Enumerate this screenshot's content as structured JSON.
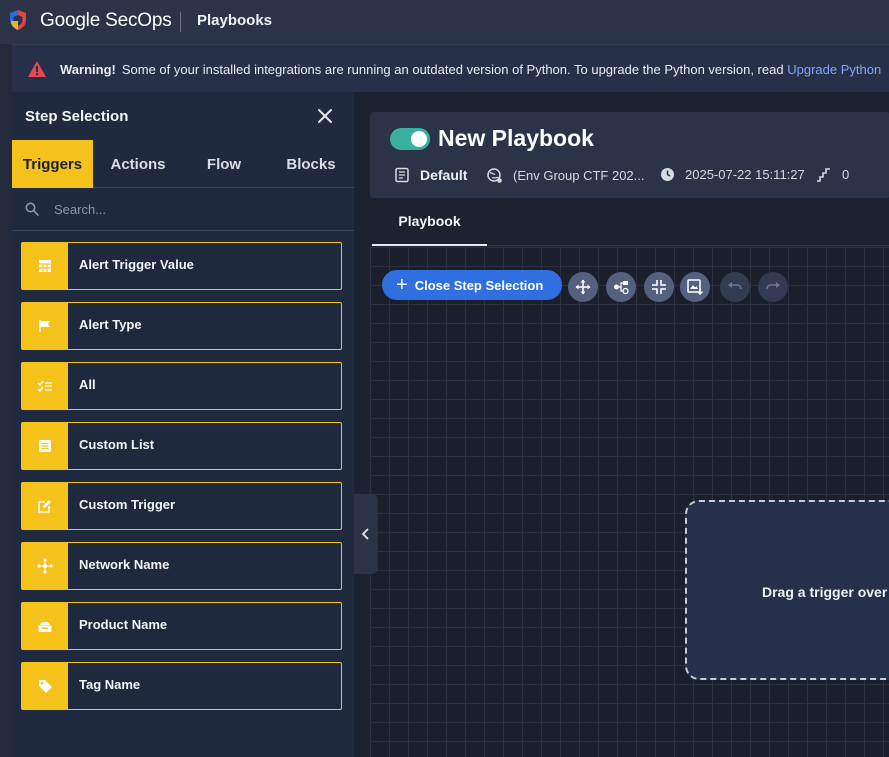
{
  "topbar": {
    "brand_google": "Google",
    "brand_product": "SecOps",
    "app_title": "Playbooks"
  },
  "banner": {
    "strong": "Warning!",
    "text": "Some of your installed integrations are running an outdated version of Python. To upgrade the Python version, read",
    "link": "Upgrade Python"
  },
  "panel": {
    "title": "Step Selection",
    "tabs": [
      "Triggers",
      "Actions",
      "Flow",
      "Blocks"
    ],
    "active_tab": "Triggers",
    "search_placeholder": "Search...",
    "triggers": [
      {
        "label": "Alert Trigger Value",
        "icon": "grid-icon"
      },
      {
        "label": "Alert Type",
        "icon": "flag-icon"
      },
      {
        "label": "All",
        "icon": "checklist-icon"
      },
      {
        "label": "Custom List",
        "icon": "list-icon"
      },
      {
        "label": "Custom Trigger",
        "icon": "edit-icon"
      },
      {
        "label": "Network Name",
        "icon": "network-icon"
      },
      {
        "label": "Product Name",
        "icon": "product-icon"
      },
      {
        "label": "Tag Name",
        "icon": "tag-icon"
      }
    ]
  },
  "playbook": {
    "title": "New Playbook",
    "enabled": true,
    "folder": "Default",
    "environment": "(Env Group CTF 202...",
    "timestamp": "2025-07-22 15:11:27",
    "steps_count": "0",
    "tab": "Playbook"
  },
  "canvas": {
    "close_step_label": "Close Step Selection",
    "tools": [
      "move-icon",
      "layout-icon",
      "fit-screen-icon",
      "export-image-icon",
      "undo-icon",
      "redo-icon"
    ],
    "dropzone_text": "Drag a trigger over"
  },
  "colors": {
    "accent_yellow": "#f5c21b",
    "primary_blue": "#2f6fe0",
    "toggle_green": "#3ab09e",
    "link_blue": "#7fa7ff"
  }
}
